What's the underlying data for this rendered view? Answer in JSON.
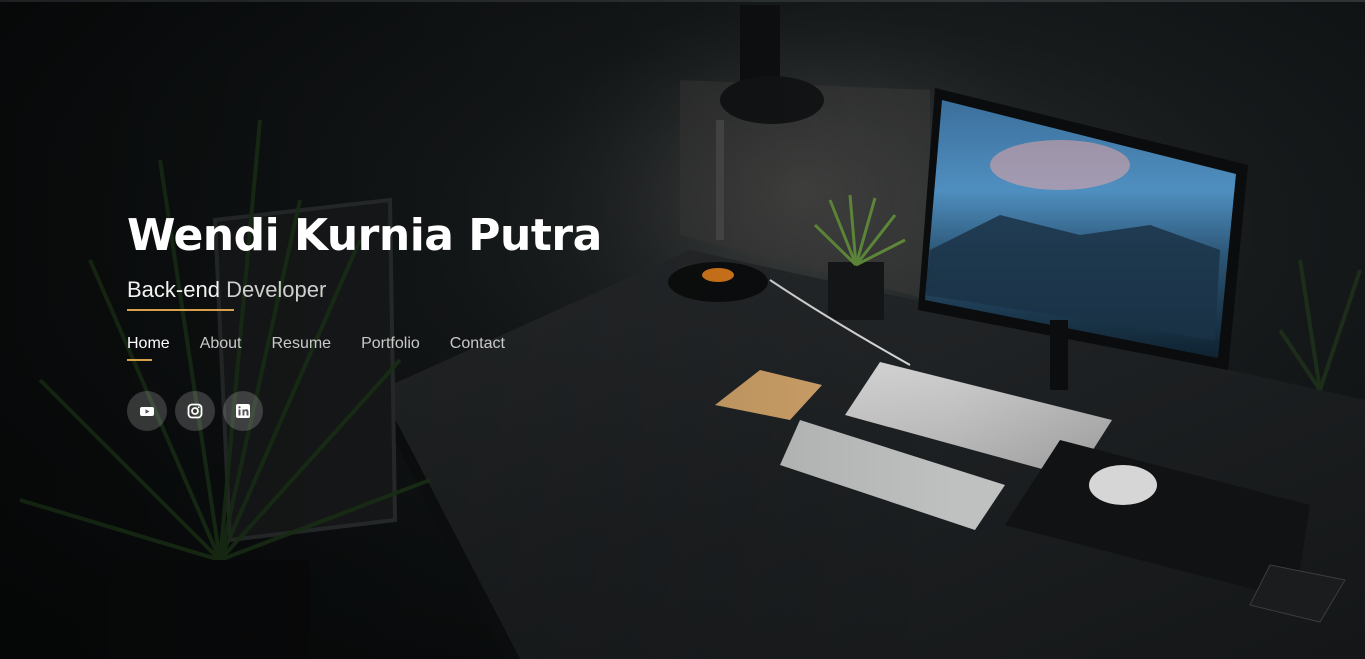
{
  "hero": {
    "name": "Wendi Kurnia Putra",
    "role_part1": "Back-end",
    "role_part2": " Developer",
    "accent_color": "#d7a04a"
  },
  "nav": {
    "items": [
      {
        "label": "Home",
        "active": true
      },
      {
        "label": "About",
        "active": false
      },
      {
        "label": "Resume",
        "active": false
      },
      {
        "label": "Portfolio",
        "active": false
      },
      {
        "label": "Contact",
        "active": false
      }
    ]
  },
  "social": {
    "icons": [
      "youtube-icon",
      "instagram-icon",
      "linkedin-icon"
    ]
  }
}
